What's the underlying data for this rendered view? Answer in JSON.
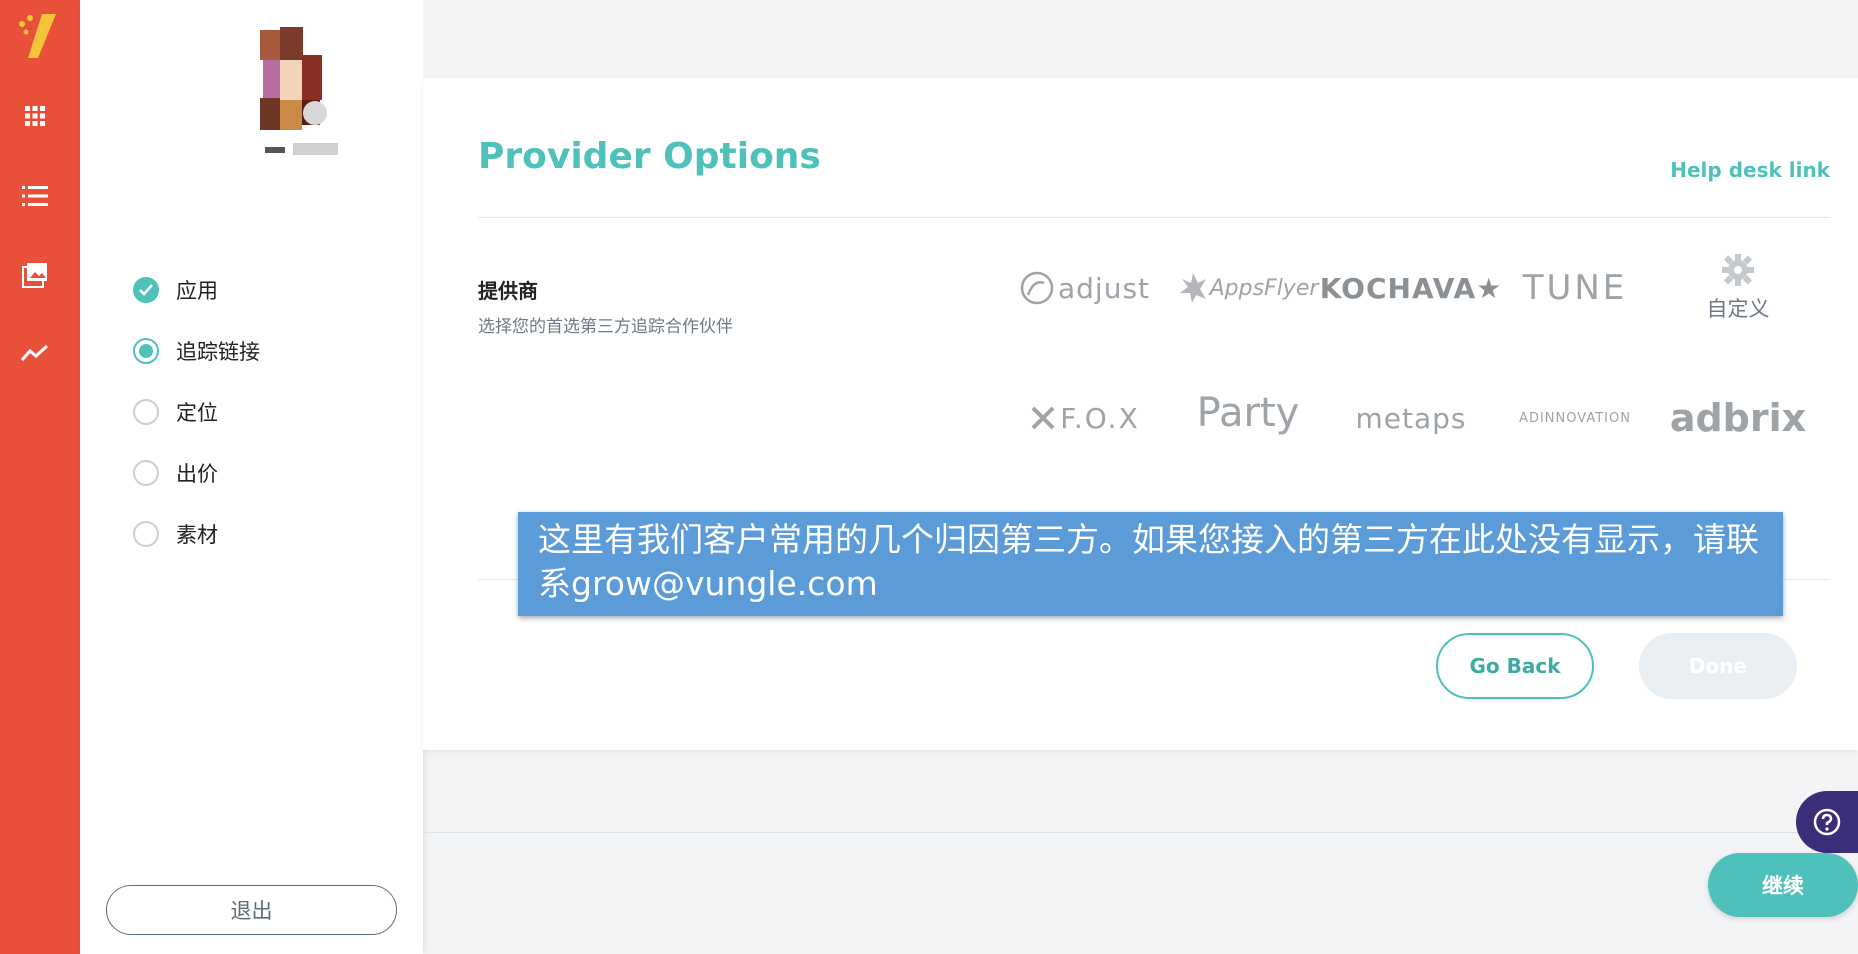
{
  "sidebar": {
    "nav_icons": [
      "vungle-logo-icon",
      "apps-grid-icon",
      "list-icon",
      "creatives-icon",
      "reports-trend-icon"
    ],
    "steps": [
      {
        "label": "应用",
        "state": "done"
      },
      {
        "label": "追踪链接",
        "state": "active"
      },
      {
        "label": "定位",
        "state": "pending"
      },
      {
        "label": "出价",
        "state": "pending"
      },
      {
        "label": "素材",
        "state": "pending"
      }
    ],
    "logout_label": "退出"
  },
  "main": {
    "title": "Provider Options",
    "help_link": "Help desk link",
    "section_title": "提供商",
    "section_subtitle": "选择您的首选第三方追踪合作伙伴",
    "providers_row1": [
      "adjust",
      "AppsFlyer",
      "KOCHAVA★",
      "TUNE",
      "自定义"
    ],
    "providers_row2": [
      "F.O.X",
      "Party",
      "metaps",
      "ADINNOVATION",
      "adbrix"
    ],
    "go_back_label": "Go Back",
    "done_label": "Done",
    "tooltip": "这里有我们客户常用的几个归因第三方。如果您接入的第三方在此处没有显示，请联系grow@vungle.com"
  },
  "footer": {
    "continue_label": "继续",
    "help_icon": "question-circle-icon"
  },
  "colors": {
    "rail": "#e8503a",
    "accent": "#4fc1bb",
    "tooltip": "#5b9bd8",
    "help_fab": "#3b2d7a"
  }
}
